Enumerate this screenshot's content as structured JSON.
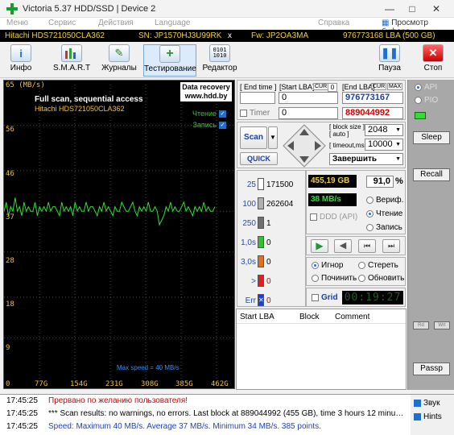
{
  "window": {
    "title": "Victoria 5.37 HDD/SSD | Device 2",
    "buttons": [
      "—",
      "□",
      "✕"
    ]
  },
  "menu": {
    "items": [
      "Меню",
      "Сервис",
      "Действия",
      "Language",
      "Справка"
    ],
    "buffer_viewer": "Просмотр буфера"
  },
  "infobar": {
    "model": "Hitachi HDS721050CLA362",
    "serial": "SN: JP1570HJ3U99RK",
    "close": "x",
    "firmware": "Fw: JP2OA3MA",
    "lba": "976773168 LBA (500 GB)"
  },
  "toolbar": {
    "info": "Инфо",
    "smart": "S.M.A.R.T",
    "logs": "Журналы",
    "testing": "Тестирование",
    "editor": "Редактор",
    "pause": "Пауза",
    "stop": "Стоп"
  },
  "graph": {
    "ylabel_top": "65 (MB/s)",
    "yticks": [
      "56",
      "46",
      "37",
      "28",
      "18",
      "9"
    ],
    "xticks": [
      "0",
      "77G",
      "154G",
      "231G",
      "308G",
      "385G",
      "462G"
    ],
    "banner_line1": "Data recovery",
    "banner_line2": "www.hdd.by",
    "scan_title": "Full scan, sequential access",
    "scan_model": "Hitachi HDS721050CLA362",
    "read_label": "Чтение",
    "write_label": "Запись",
    "max_speed_label": "Max speed = 40 MB/s",
    "line_color": "#30e030",
    "series_mbps": [
      37,
      39,
      36,
      38,
      37,
      40,
      37,
      38,
      36,
      39,
      37,
      38,
      37,
      37,
      39,
      36,
      38,
      37,
      38,
      37,
      39,
      37,
      38,
      38,
      37,
      36,
      39,
      37,
      38,
      37,
      38,
      36,
      39,
      37,
      38,
      37,
      37,
      39,
      37,
      38,
      38,
      37,
      36,
      38,
      37,
      39,
      37,
      38,
      37,
      36,
      38,
      37,
      37,
      39,
      38,
      37,
      37,
      38,
      39,
      37,
      36,
      38,
      37,
      38,
      37,
      39,
      37,
      37,
      38,
      37,
      34,
      35,
      36,
      38,
      37,
      39,
      37,
      38,
      37,
      37,
      38,
      39,
      37,
      38,
      37,
      36,
      38,
      37,
      38,
      37,
      39,
      37,
      38,
      37,
      37,
      38
    ]
  },
  "lba_panel": {
    "end_time_label": "[ End time ]",
    "start_lba_label": "[Start LBA]",
    "cur_label": "CUR",
    "cur_value": "0",
    "end_lba_label": "[End LBA]",
    "cur2_label": "CUR",
    "max_label": "MAX",
    "end_time_value": "",
    "start_lba_value": "0",
    "end_lba_value": "976773167",
    "timer_label": "Timer",
    "timer_value": "0",
    "cur_lba_value": "889044992"
  },
  "scan_panel": {
    "scan_button": "Scan",
    "quick_button": "QUICK",
    "block_size_label": "[ block size ]",
    "auto_label": "[ auto ]",
    "block_size_value": "2048",
    "timeout_label": "[ timeout,ms ]",
    "timeout_value": "10000",
    "finish_value": "Завершить"
  },
  "legend": [
    {
      "label": "25",
      "value": "171500",
      "color": "#ffffff"
    },
    {
      "label": "100",
      "value": "262604",
      "color": "#b0b0b0"
    },
    {
      "label": "250",
      "value": "1",
      "color": "#707070"
    },
    {
      "label": "1,0s",
      "value": "0",
      "color": "#30c030"
    },
    {
      "label": "3,0s",
      "value": "0",
      "color": "#e07020"
    },
    {
      "label": ">",
      "value": "0",
      "color": "#e02020"
    },
    {
      "label": "Err",
      "value": "0",
      "color": "#1e3fd0"
    }
  ],
  "stats": {
    "done_gb": "455,19 GB",
    "percent": "91,0",
    "percent_sign": "%",
    "speed": "38 MB/s",
    "ddd_label": "DDD (API)",
    "verify": "Вериф.",
    "read": "Чтение",
    "write": "Запись"
  },
  "actions": {
    "ignore": "Игнор",
    "erase": "Стереть",
    "repair": "Починить",
    "refresh": "Обновить",
    "grid": "Grid",
    "clock": "00:19:27"
  },
  "table": {
    "headers": [
      "Start LBA",
      "Block",
      "Comment"
    ]
  },
  "side": {
    "api": "API",
    "pio": "PIO",
    "sleep": "Sleep",
    "recall": "Recall",
    "rd": "Rd",
    "wrt": "Wrt",
    "passp": "Passp"
  },
  "log": {
    "lines": [
      {
        "time": "17:45:25",
        "text": "Прервано по желанию пользователя!",
        "color": "#d00000"
      },
      {
        "time": "17:45:25",
        "text": "*** Scan results: no warnings, no errors. Last block at 889044992 (455 GB), time 3 hours 12 minu…",
        "color": "#000000"
      },
      {
        "time": "17:45:25",
        "text": "Speed: Maximum 40 MB/s. Average 37 MB/s. Minimum 34 MB/s. 385 points.",
        "color": "#1a3fd0"
      }
    ],
    "sound_label": "Звук",
    "hints_label": "Hints"
  }
}
